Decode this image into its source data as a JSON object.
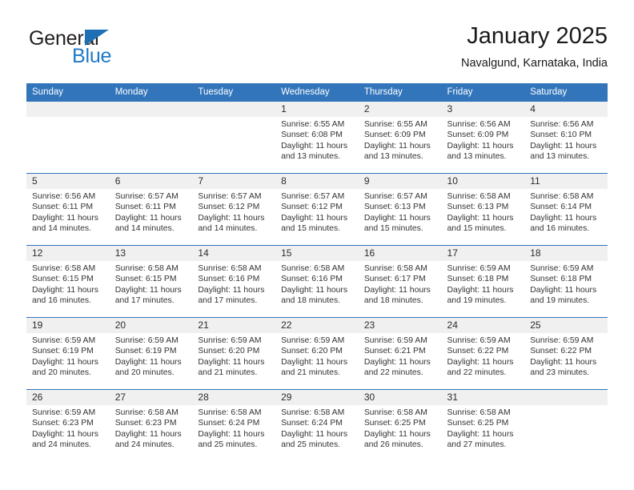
{
  "brand": {
    "name_part1": "General",
    "name_part2": "Blue",
    "triangle_color": "#1f6fb4",
    "blue_color": "#2079c6"
  },
  "header": {
    "title": "January 2025",
    "subtitle": "Navalgund, Karnataka, India"
  },
  "theme": {
    "header_bar": "#3275bb",
    "daynum_band": "#f0f0f0",
    "text": "#333333"
  },
  "weekdays": [
    "Sunday",
    "Monday",
    "Tuesday",
    "Wednesday",
    "Thursday",
    "Friday",
    "Saturday"
  ],
  "weeks": [
    [
      {
        "day": "",
        "empty": true
      },
      {
        "day": "",
        "empty": true
      },
      {
        "day": "",
        "empty": true
      },
      {
        "day": "1",
        "sunrise": "Sunrise: 6:55 AM",
        "sunset": "Sunset: 6:08 PM",
        "daylight": "Daylight: 11 hours and 13 minutes."
      },
      {
        "day": "2",
        "sunrise": "Sunrise: 6:55 AM",
        "sunset": "Sunset: 6:09 PM",
        "daylight": "Daylight: 11 hours and 13 minutes."
      },
      {
        "day": "3",
        "sunrise": "Sunrise: 6:56 AM",
        "sunset": "Sunset: 6:09 PM",
        "daylight": "Daylight: 11 hours and 13 minutes."
      },
      {
        "day": "4",
        "sunrise": "Sunrise: 6:56 AM",
        "sunset": "Sunset: 6:10 PM",
        "daylight": "Daylight: 11 hours and 13 minutes."
      }
    ],
    [
      {
        "day": "5",
        "sunrise": "Sunrise: 6:56 AM",
        "sunset": "Sunset: 6:11 PM",
        "daylight": "Daylight: 11 hours and 14 minutes."
      },
      {
        "day": "6",
        "sunrise": "Sunrise: 6:57 AM",
        "sunset": "Sunset: 6:11 PM",
        "daylight": "Daylight: 11 hours and 14 minutes."
      },
      {
        "day": "7",
        "sunrise": "Sunrise: 6:57 AM",
        "sunset": "Sunset: 6:12 PM",
        "daylight": "Daylight: 11 hours and 14 minutes."
      },
      {
        "day": "8",
        "sunrise": "Sunrise: 6:57 AM",
        "sunset": "Sunset: 6:12 PM",
        "daylight": "Daylight: 11 hours and 15 minutes."
      },
      {
        "day": "9",
        "sunrise": "Sunrise: 6:57 AM",
        "sunset": "Sunset: 6:13 PM",
        "daylight": "Daylight: 11 hours and 15 minutes."
      },
      {
        "day": "10",
        "sunrise": "Sunrise: 6:58 AM",
        "sunset": "Sunset: 6:13 PM",
        "daylight": "Daylight: 11 hours and 15 minutes."
      },
      {
        "day": "11",
        "sunrise": "Sunrise: 6:58 AM",
        "sunset": "Sunset: 6:14 PM",
        "daylight": "Daylight: 11 hours and 16 minutes."
      }
    ],
    [
      {
        "day": "12",
        "sunrise": "Sunrise: 6:58 AM",
        "sunset": "Sunset: 6:15 PM",
        "daylight": "Daylight: 11 hours and 16 minutes."
      },
      {
        "day": "13",
        "sunrise": "Sunrise: 6:58 AM",
        "sunset": "Sunset: 6:15 PM",
        "daylight": "Daylight: 11 hours and 17 minutes."
      },
      {
        "day": "14",
        "sunrise": "Sunrise: 6:58 AM",
        "sunset": "Sunset: 6:16 PM",
        "daylight": "Daylight: 11 hours and 17 minutes."
      },
      {
        "day": "15",
        "sunrise": "Sunrise: 6:58 AM",
        "sunset": "Sunset: 6:16 PM",
        "daylight": "Daylight: 11 hours and 18 minutes."
      },
      {
        "day": "16",
        "sunrise": "Sunrise: 6:58 AM",
        "sunset": "Sunset: 6:17 PM",
        "daylight": "Daylight: 11 hours and 18 minutes."
      },
      {
        "day": "17",
        "sunrise": "Sunrise: 6:59 AM",
        "sunset": "Sunset: 6:18 PM",
        "daylight": "Daylight: 11 hours and 19 minutes."
      },
      {
        "day": "18",
        "sunrise": "Sunrise: 6:59 AM",
        "sunset": "Sunset: 6:18 PM",
        "daylight": "Daylight: 11 hours and 19 minutes."
      }
    ],
    [
      {
        "day": "19",
        "sunrise": "Sunrise: 6:59 AM",
        "sunset": "Sunset: 6:19 PM",
        "daylight": "Daylight: 11 hours and 20 minutes."
      },
      {
        "day": "20",
        "sunrise": "Sunrise: 6:59 AM",
        "sunset": "Sunset: 6:19 PM",
        "daylight": "Daylight: 11 hours and 20 minutes."
      },
      {
        "day": "21",
        "sunrise": "Sunrise: 6:59 AM",
        "sunset": "Sunset: 6:20 PM",
        "daylight": "Daylight: 11 hours and 21 minutes."
      },
      {
        "day": "22",
        "sunrise": "Sunrise: 6:59 AM",
        "sunset": "Sunset: 6:20 PM",
        "daylight": "Daylight: 11 hours and 21 minutes."
      },
      {
        "day": "23",
        "sunrise": "Sunrise: 6:59 AM",
        "sunset": "Sunset: 6:21 PM",
        "daylight": "Daylight: 11 hours and 22 minutes."
      },
      {
        "day": "24",
        "sunrise": "Sunrise: 6:59 AM",
        "sunset": "Sunset: 6:22 PM",
        "daylight": "Daylight: 11 hours and 22 minutes."
      },
      {
        "day": "25",
        "sunrise": "Sunrise: 6:59 AM",
        "sunset": "Sunset: 6:22 PM",
        "daylight": "Daylight: 11 hours and 23 minutes."
      }
    ],
    [
      {
        "day": "26",
        "sunrise": "Sunrise: 6:59 AM",
        "sunset": "Sunset: 6:23 PM",
        "daylight": "Daylight: 11 hours and 24 minutes."
      },
      {
        "day": "27",
        "sunrise": "Sunrise: 6:58 AM",
        "sunset": "Sunset: 6:23 PM",
        "daylight": "Daylight: 11 hours and 24 minutes."
      },
      {
        "day": "28",
        "sunrise": "Sunrise: 6:58 AM",
        "sunset": "Sunset: 6:24 PM",
        "daylight": "Daylight: 11 hours and 25 minutes."
      },
      {
        "day": "29",
        "sunrise": "Sunrise: 6:58 AM",
        "sunset": "Sunset: 6:24 PM",
        "daylight": "Daylight: 11 hours and 25 minutes."
      },
      {
        "day": "30",
        "sunrise": "Sunrise: 6:58 AM",
        "sunset": "Sunset: 6:25 PM",
        "daylight": "Daylight: 11 hours and 26 minutes."
      },
      {
        "day": "31",
        "sunrise": "Sunrise: 6:58 AM",
        "sunset": "Sunset: 6:25 PM",
        "daylight": "Daylight: 11 hours and 27 minutes."
      },
      {
        "day": "",
        "empty": true
      }
    ]
  ]
}
